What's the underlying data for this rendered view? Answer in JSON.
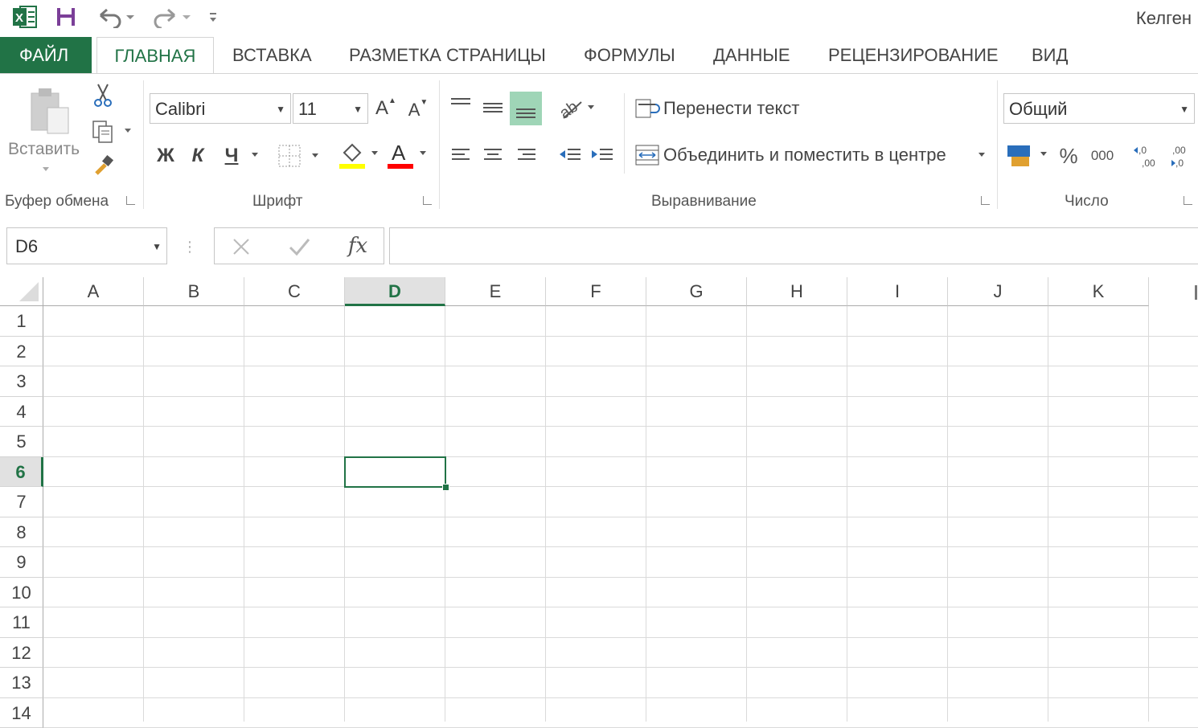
{
  "title_bar": {
    "user": "Келген"
  },
  "tabs": [
    "ФАЙЛ",
    "ГЛАВНАЯ",
    "ВСТАВКА",
    "РАЗМЕТКА СТРАНИЦЫ",
    "ФОРМУЛЫ",
    "ДАННЫЕ",
    "РЕЦЕНЗИРОВАНИЕ",
    "ВИД"
  ],
  "ribbon": {
    "clipboard": {
      "paste_label": "Вставить",
      "group_label": "Буфер обмена"
    },
    "font": {
      "font_name": "Calibri",
      "font_size": "11",
      "bold": "Ж",
      "italic": "К",
      "underline": "Ч",
      "grow": "A",
      "shrink": "A",
      "font_color_letter": "A",
      "group_label": "Шрифт"
    },
    "alignment": {
      "wrap_text": "Перенести текст",
      "merge_center": "Объединить и поместить в центре",
      "group_label": "Выравнивание"
    },
    "number": {
      "format": "Общий",
      "percent": "%",
      "thousands": "000",
      "inc_decimal": ",00",
      "dec_decimal": ",0",
      "group_label": "Число"
    }
  },
  "formula_bar": {
    "name_box": "D6",
    "fx": "fx",
    "formula": ""
  },
  "grid": {
    "columns": [
      "A",
      "B",
      "C",
      "D",
      "E",
      "F",
      "G",
      "H",
      "I",
      "J",
      "K"
    ],
    "rows": [
      "1",
      "2",
      "3",
      "4",
      "5",
      "6",
      "7",
      "8",
      "9",
      "10",
      "11",
      "12",
      "13",
      "14"
    ],
    "selected_cell": "D6",
    "selected_column": "D",
    "selected_row": "6"
  },
  "colors": {
    "accent": "#217346",
    "font_highlight": "#ffff00",
    "font_color": "#ff0000"
  }
}
